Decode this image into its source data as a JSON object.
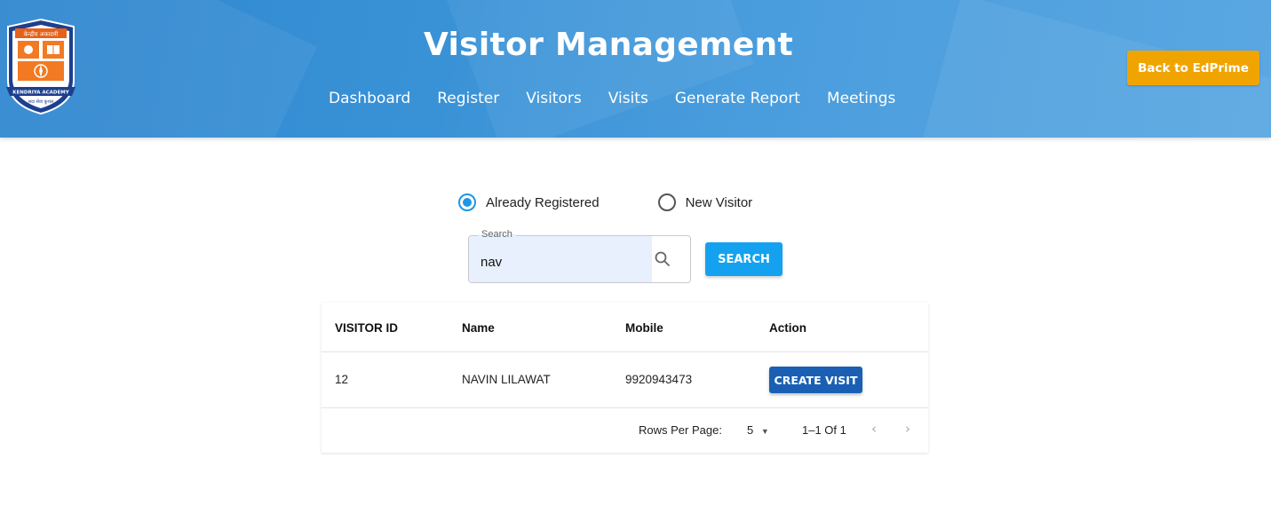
{
  "header": {
    "title": "Visitor Management",
    "back_button": "Back to EdPrime",
    "logo": {
      "text_top": "केन्द्रीय अकादमी",
      "text_bottom": "सदा सेवा कुशल",
      "ribbon": "KENDRIYA ACADEMY"
    },
    "nav": [
      "Dashboard",
      "Register",
      "Visitors",
      "Visits",
      "Generate Report",
      "Meetings"
    ]
  },
  "visitor_type": {
    "options": [
      "Already Registered",
      "New Visitor"
    ],
    "selected": "Already Registered"
  },
  "search": {
    "label": "Search",
    "value": "nav",
    "button": "SEARCH"
  },
  "table": {
    "columns": [
      "VISITOR ID",
      "Name",
      "Mobile",
      "Action"
    ],
    "rows": [
      {
        "id": "12",
        "name": "NAVIN LILAWAT",
        "mobile": "9920943473",
        "action": "CREATE VISIT"
      }
    ],
    "pagination": {
      "rows_per_page_label": "Rows Per Page:",
      "rows_per_page": "5",
      "range": "1–1 Of 1"
    }
  },
  "colors": {
    "header_blue": "#3a92d6",
    "back_button": "#f0a400",
    "search_button": "#14a2f0",
    "create_visit_button": "#1a5fb4",
    "radio_accent": "#1e96e8"
  }
}
